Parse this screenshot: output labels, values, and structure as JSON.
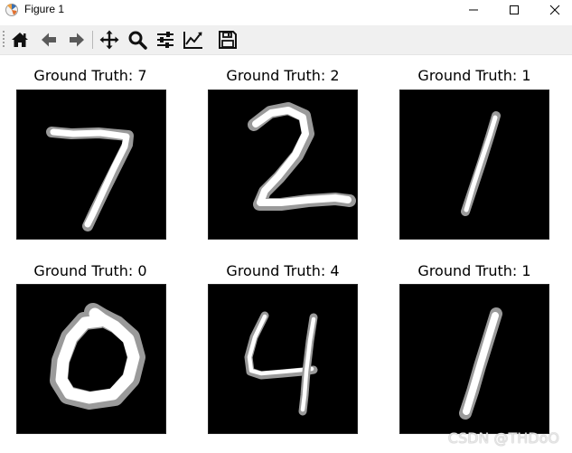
{
  "window": {
    "title": "Figure 1"
  },
  "toolbar": {
    "tools": [
      {
        "name": "home-icon"
      },
      {
        "name": "back-arrow-icon"
      },
      {
        "name": "forward-arrow-icon"
      },
      {
        "name": "pan-icon"
      },
      {
        "name": "zoom-icon"
      },
      {
        "name": "configure-subplots-icon"
      },
      {
        "name": "edit-axis-icon"
      },
      {
        "name": "save-icon"
      }
    ]
  },
  "figure": {
    "subplots": [
      {
        "title": "Ground Truth: 7",
        "digit": "7"
      },
      {
        "title": "Ground Truth: 2",
        "digit": "2"
      },
      {
        "title": "Ground Truth: 1",
        "digit": "1"
      },
      {
        "title": "Ground Truth: 0",
        "digit": "0"
      },
      {
        "title": "Ground Truth: 4",
        "digit": "4"
      },
      {
        "title": "Ground Truth: 1",
        "digit": "1"
      }
    ]
  },
  "watermark": "CSDN @THDoO"
}
